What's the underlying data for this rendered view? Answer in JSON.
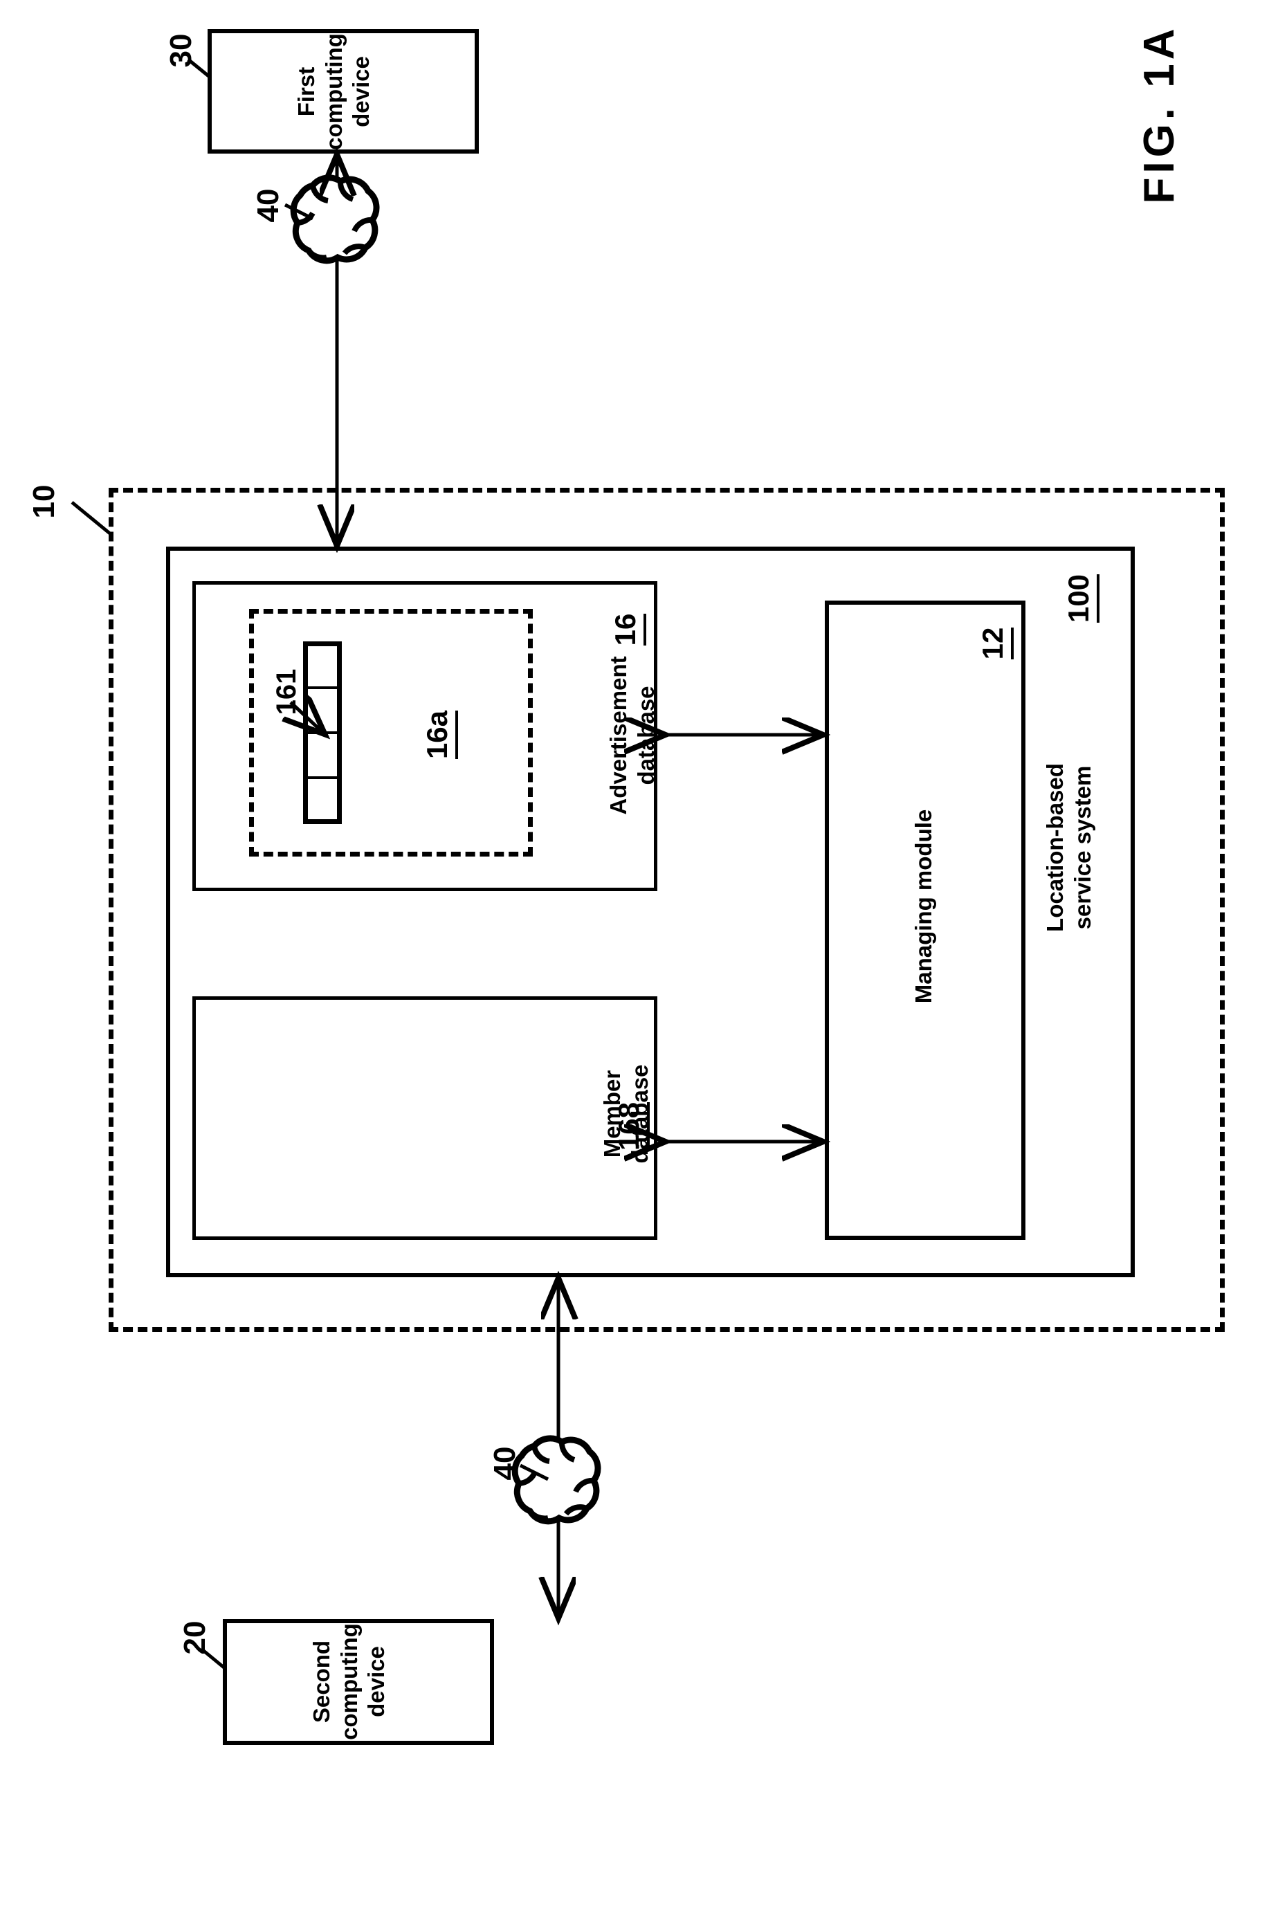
{
  "figure": {
    "title": "FIG. 1A",
    "orientation": "landscape-sideways"
  },
  "nodes": {
    "first_device": {
      "label": "First\ncomputing\ndevice",
      "ref": "30"
    },
    "second_device": {
      "label": "Second\ncomputing\ndevice",
      "ref": "20"
    },
    "network_top": {
      "label": "",
      "ref": "40",
      "icon": "cloud-icon"
    },
    "network_bottom": {
      "label": "",
      "ref": "40",
      "icon": "cloud-icon"
    },
    "outer_boundary": {
      "ref": "10"
    },
    "service_system": {
      "label": "Location-based\nservice system",
      "ref": "100"
    },
    "advertisement_database": {
      "label": "Advertisement\ndatabase",
      "ref": "16"
    },
    "advertisement_group": {
      "ref": "16a",
      "cell_count": 4
    },
    "advertisement_cell": {
      "ref": "161"
    },
    "member_database": {
      "label": "Member\ndatabase",
      "ref": "168"
    },
    "managing_module": {
      "label": "Managing module",
      "ref": "12"
    }
  },
  "connections": [
    {
      "from": "network_top",
      "to": "first_device",
      "type": "arrow-single"
    },
    {
      "from": "network_top",
      "to": "service_system",
      "type": "arrow-single"
    },
    {
      "from": "network_bottom",
      "to": "second_device",
      "type": "arrow-single"
    },
    {
      "from": "network_bottom",
      "to": "service_system",
      "type": "arrow-single"
    },
    {
      "from": "advertisement_database",
      "to": "managing_module",
      "type": "arrow-double"
    },
    {
      "from": "member_database",
      "to": "managing_module",
      "type": "arrow-double"
    }
  ],
  "colors": {
    "ink": "#000000",
    "paper": "#ffffff"
  }
}
